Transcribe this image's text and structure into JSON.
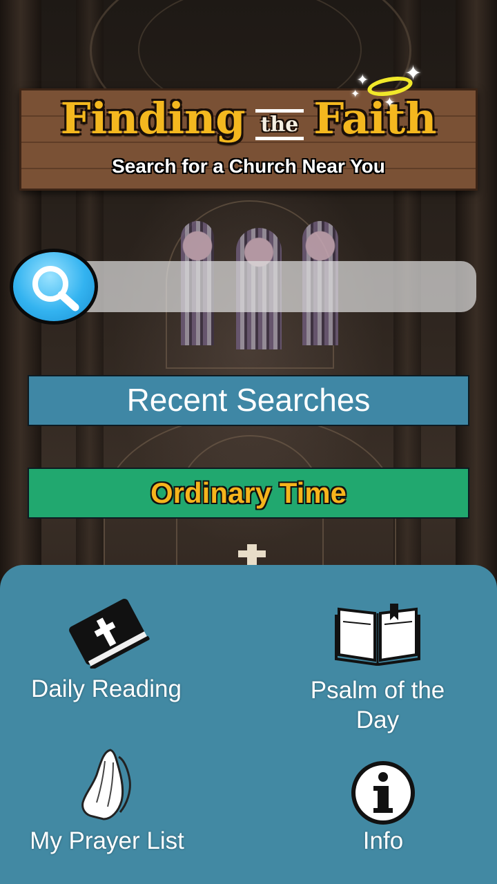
{
  "header": {
    "title_part1": "Finding",
    "title_the": "the",
    "title_part2": "Faith",
    "subtitle": "Search for a Church Near You"
  },
  "search": {
    "value": "",
    "placeholder": ""
  },
  "buttons": {
    "recent_searches": "Recent Searches",
    "liturgical_season": "Ordinary Time"
  },
  "menu": {
    "daily_reading": "Daily Reading",
    "psalm_of_the_day": "Psalm of the Day",
    "prayer_list": "My Prayer List",
    "info": "Info"
  },
  "icons": [
    "search-icon",
    "bible-icon",
    "open-book-icon",
    "praying-hands-icon",
    "info-icon",
    "halo-icon"
  ],
  "colors": {
    "title": "#f4b81f",
    "recent_button": "#3f87a5",
    "season_button": "#21a86f",
    "season_text": "#f6b41c",
    "panel": "#4289a3",
    "search_button": "#33b3f0"
  }
}
